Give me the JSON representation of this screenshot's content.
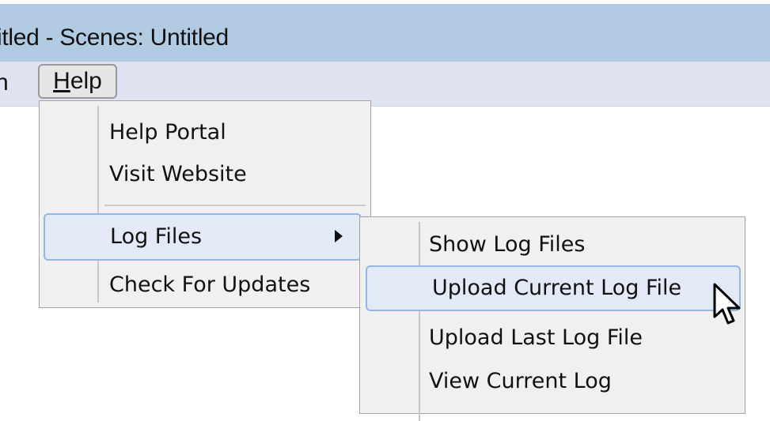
{
  "window": {
    "title": "itled - Scenes: Untitled"
  },
  "menubar": {
    "partial_item": "n",
    "help": {
      "mnemonic": "H",
      "rest": "elp"
    }
  },
  "help_menu": {
    "items": [
      {
        "label": "Help Portal"
      },
      {
        "label": "Visit Website"
      },
      {
        "label": "Log Files",
        "has_submenu": true,
        "highlighted": true
      },
      {
        "label": "Check For Updates"
      }
    ]
  },
  "log_files_submenu": {
    "items": [
      {
        "label": "Show Log Files"
      },
      {
        "label": "Upload Current Log File",
        "highlighted": true
      },
      {
        "label": "Upload Last Log File"
      },
      {
        "label": "View Current Log"
      }
    ]
  },
  "colors": {
    "titlebar": "#b1cbe3",
    "menubar": "#dfe3f1",
    "menu_background": "#f0f0f0",
    "highlight_fill": "#e3e9f6",
    "highlight_border": "#92b6ea"
  },
  "cursor": "arrow-pointer"
}
